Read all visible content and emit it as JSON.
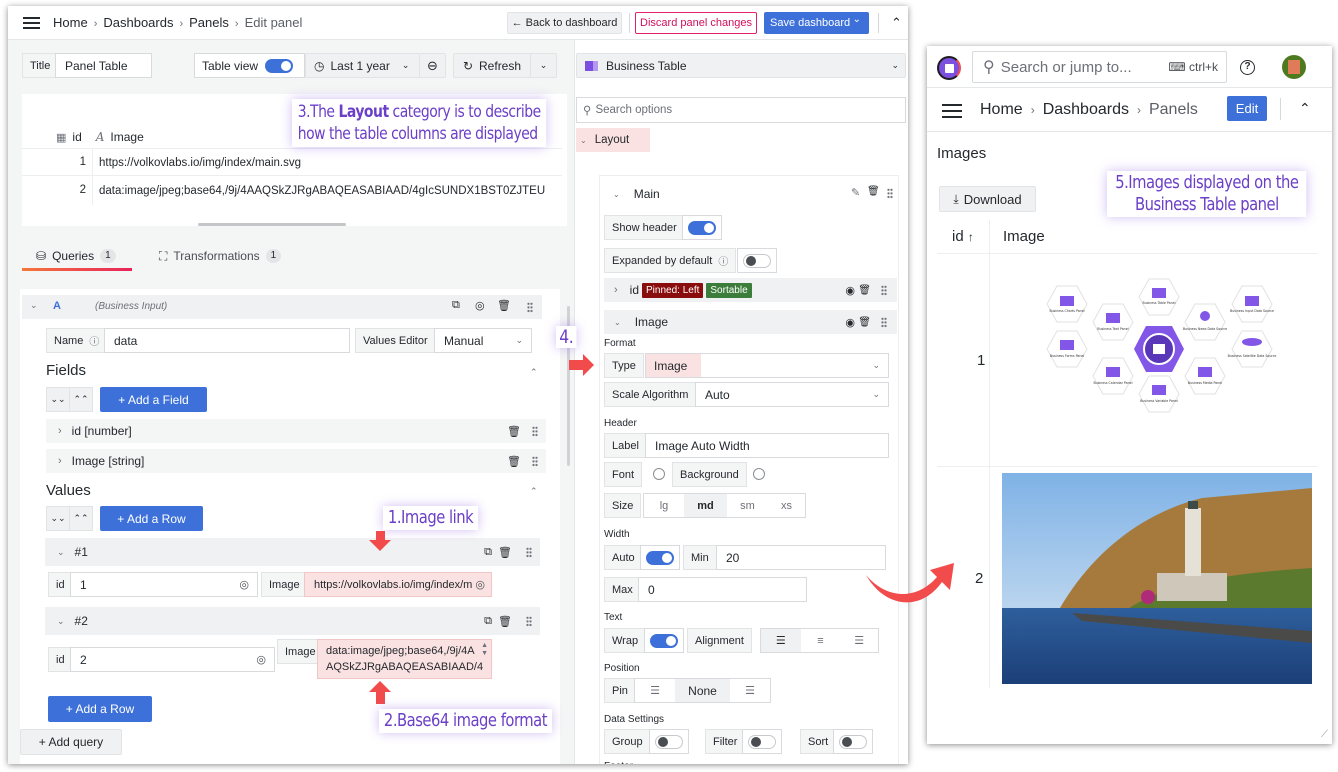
{
  "editor": {
    "breadcrumb": [
      "Home",
      "Dashboards",
      "Panels",
      "Edit panel"
    ],
    "buttons": {
      "back": "← Back to dashboard",
      "discard": "Discard panel changes",
      "save": "Save dashboard",
      "save_caret": "⌄",
      "collapse": "^"
    },
    "toolbar": {
      "title_label": "Title",
      "title_value": "Panel Table",
      "table_view_label": "Table view",
      "table_view_on": true,
      "time_range": "Last 1 year",
      "refresh": "Refresh"
    },
    "preview": {
      "columns": [
        {
          "icon": "number-icon",
          "label": "id"
        },
        {
          "icon": "string-icon",
          "label": "Image"
        }
      ],
      "rows": [
        {
          "id": "1",
          "image": "https://volkovlabs.io/img/index/main.svg"
        },
        {
          "id": "2",
          "image": "data:image/jpeg;base64,/9j/4AAQSkZJRgABAQEASABIAAD/4gIcSUNDX1BST0ZJTEU"
        }
      ]
    },
    "tabs": [
      {
        "label": "Queries",
        "count": "1",
        "active": true
      },
      {
        "label": "Transformations",
        "count": "1",
        "active": false
      }
    ],
    "query": {
      "ref": "A",
      "datasource": "(Business Input)",
      "name_label": "Name",
      "name_value": "data",
      "values_editor_label": "Values Editor",
      "values_editor_value": "Manual",
      "fields_title": "Fields",
      "add_field": "+ Add a Field",
      "fields": [
        "id [number]",
        "Image [string]"
      ],
      "values_title": "Values",
      "add_row": "+ Add a Row",
      "rows": [
        {
          "title": "#1",
          "id_label": "id",
          "id_value": "1",
          "image_label": "Image",
          "image_value": "https://volkovlabs.io/img/index/m"
        },
        {
          "title": "#2",
          "id_label": "id",
          "id_value": "2",
          "image_label": "Image",
          "image_value_line1": "data:image/jpeg;base64,/9j/4A",
          "image_value_line2": "AQSkZJRgABAQEASABIAAD/4"
        }
      ],
      "add_row_bottom": "+ Add a Row",
      "add_query": "+ Add query"
    },
    "options": {
      "visualization": "Business Table",
      "search_placeholder": "Search options",
      "category": "Layout",
      "group_name": "Main",
      "show_header_label": "Show header",
      "show_header_on": true,
      "expanded_label": "Expanded by default",
      "expanded_on": false,
      "columns": [
        {
          "name": "id",
          "badges": [
            "Pinned: Left",
            "Sortable"
          ],
          "expanded": false
        },
        {
          "name": "Image",
          "badges": [],
          "expanded": true
        }
      ],
      "format_title": "Format",
      "type_label": "Type",
      "type_value": "Image",
      "scale_label": "Scale Algorithm",
      "scale_value": "Auto",
      "header_title": "Header",
      "header_label_label": "Label",
      "header_label_value": "Image Auto Width",
      "font_label": "Font",
      "background_label": "Background",
      "size_label": "Size",
      "sizes": [
        "lg",
        "md",
        "sm",
        "xs"
      ],
      "size_selected": "md",
      "width_title": "Width",
      "auto_label": "Auto",
      "auto_on": true,
      "min_label": "Min",
      "min_value": "20",
      "max_label": "Max",
      "max_value": "0",
      "text_title": "Text",
      "wrap_label": "Wrap",
      "wrap_on": true,
      "alignment_label": "Alignment",
      "alignment_selected": "left",
      "position_title": "Position",
      "pin_label": "Pin",
      "pin_value": "None",
      "data_settings_title": "Data Settings",
      "group_label": "Group",
      "filter_label": "Filter",
      "sort_label": "Sort",
      "footer_title": "Footer"
    }
  },
  "annotations": {
    "n1": "1.Image link",
    "n2": "2.Base64 image format",
    "n3_pre": "3.The ",
    "n3_bold": "Layout",
    "n3_post": " category is to describe",
    "n3_line2": "how the table columns are displayed",
    "n4": "4.",
    "n5_line1": "5.Images displayed on the",
    "n5_line2": "Business Table panel"
  },
  "viewer": {
    "search_placeholder": "Search or jump to...",
    "shortcut": "ctrl+k",
    "breadcrumb": [
      "Home",
      "Dashboards",
      "Panels"
    ],
    "edit": "Edit",
    "panel_title": "Images",
    "download": "Download",
    "columns": [
      {
        "label": "id",
        "sort": "↑"
      },
      {
        "label": "Image"
      }
    ],
    "rows": [
      {
        "id": "1",
        "image": "Business Suite hexagon diagram"
      },
      {
        "id": "2",
        "image": "Lighthouse on coastal hill photo"
      }
    ],
    "hex_labels": [
      "Business Charts Panel",
      "Business Table Panel",
      "Business Input Data Source",
      "Business Text Panel",
      "Business News Data Source",
      "Business Forms Panel",
      "Business Satellite Data Source",
      "Business Calendar Panel",
      "Business Media Panel",
      "Business Variable Panel"
    ]
  },
  "colors": {
    "primary": "#3d71d9",
    "danger": "#d10e5c",
    "annotation": "#6b3fc7",
    "arrow": "#f24b4b",
    "highlight": "#fbe2e2"
  }
}
